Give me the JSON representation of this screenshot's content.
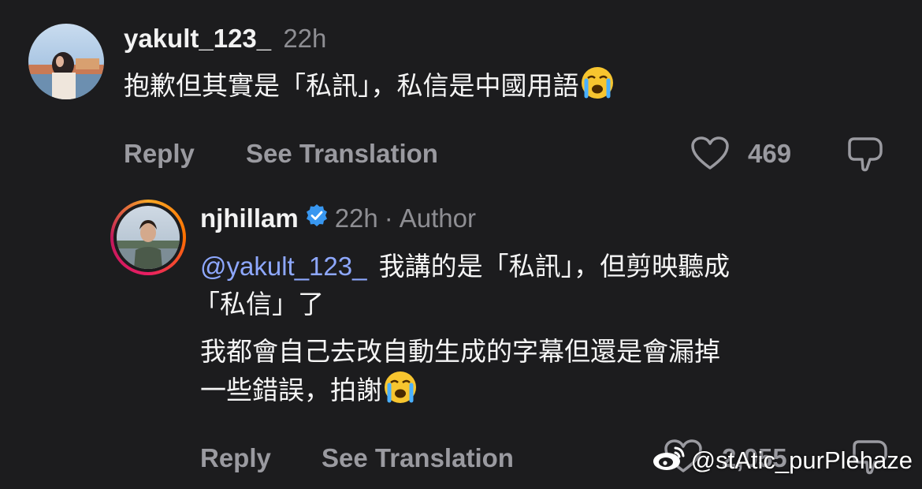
{
  "comment": {
    "username": "yakult_123_",
    "time": "22h",
    "text": "抱歉但其實是「私訊」，私信是中國用語",
    "emoji": "loudly-crying-face",
    "reply_label": "Reply",
    "translate_label": "See Translation",
    "like_count": "469"
  },
  "reply": {
    "username": "njhillam",
    "verified": true,
    "time": "22h",
    "separator": "·",
    "role": "Author",
    "mention": "@yakult_123_",
    "line1": "我講的是「私訊」，但剪映聽成",
    "line2": "「私信」了",
    "line3": "我都會自己去改自動生成的字幕但還是會漏掉",
    "line4": "一些錯誤，拍謝",
    "emoji": "loudly-crying-face",
    "reply_label": "Reply",
    "translate_label": "See Translation",
    "like_count": "2,055"
  },
  "watermark": {
    "text": "@stAtic_purPlehaze",
    "icon": "weibo-icon"
  },
  "colors": {
    "background": "#1c1c1e",
    "mention": "#8ea8ff",
    "verified": "#3897f0",
    "secondary": "#9a9aa0"
  }
}
